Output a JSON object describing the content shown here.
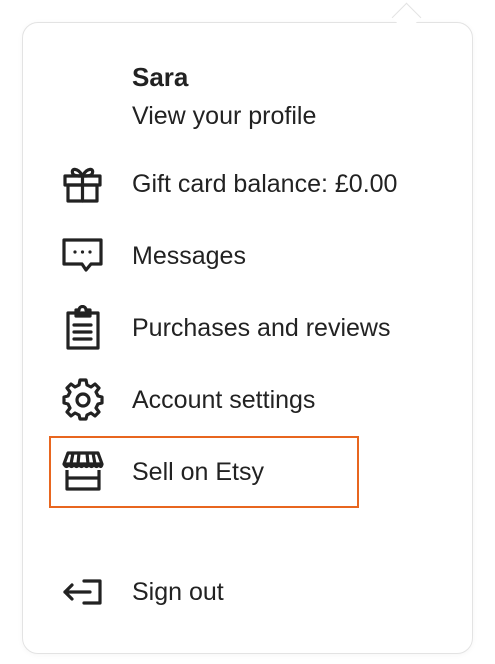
{
  "profile": {
    "name": "Sara",
    "link_label": "View your profile"
  },
  "menu_items": [
    {
      "label": "Gift card balance: £0.00",
      "icon": "gift-icon"
    },
    {
      "label": "Messages",
      "icon": "message-icon"
    },
    {
      "label": "Purchases and reviews",
      "icon": "clipboard-icon"
    },
    {
      "label": "Account settings",
      "icon": "gear-icon"
    },
    {
      "label": "Sell on Etsy",
      "icon": "shop-icon",
      "highlighted": true
    },
    {
      "label": "Sign out",
      "icon": "sign-out-icon"
    }
  ],
  "colors": {
    "text": "#222222",
    "border": "#e3e3e3",
    "highlight": "#e8661f"
  }
}
